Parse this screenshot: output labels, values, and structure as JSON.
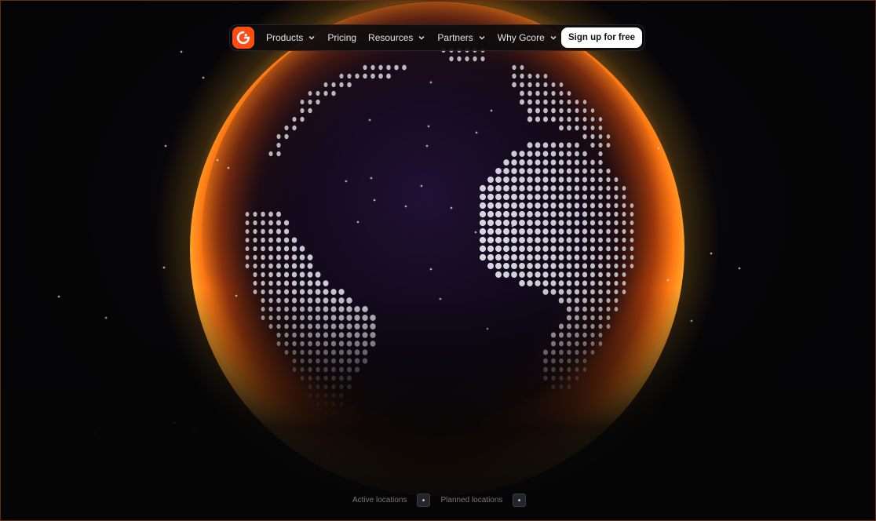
{
  "nav": {
    "logo": "gcore-logo-icon",
    "items": [
      {
        "label": "Products",
        "has_dropdown": true
      },
      {
        "label": "Pricing",
        "has_dropdown": false
      },
      {
        "label": "Resources",
        "has_dropdown": true
      },
      {
        "label": "Partners",
        "has_dropdown": true
      },
      {
        "label": "Why Gcore",
        "has_dropdown": true
      }
    ],
    "cta_label": "Sign up for free"
  },
  "legend": {
    "active_label": "Active locations",
    "planned_label": "Planned locations"
  },
  "colors": {
    "brand": "#ff4c12",
    "glow": "#ff7a1a",
    "dots": "#d9d9e0",
    "background": "#050506"
  }
}
